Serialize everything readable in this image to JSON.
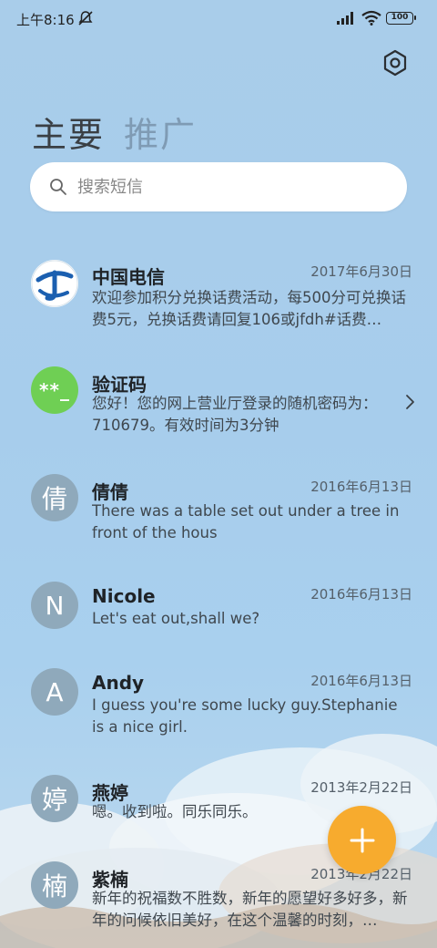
{
  "status_bar": {
    "time": "上午8:16",
    "battery": "100"
  },
  "tabs": [
    {
      "label": "主要"
    },
    {
      "label": "推广"
    }
  ],
  "search": {
    "placeholder": "搜索短信"
  },
  "conversations": [
    {
      "name": "中国电信",
      "date": "2017年6月30日",
      "preview": "欢迎参加积分兑换话费活动，每500分可兑换话费5元，兑换话费请回复106或jfdh#话费…",
      "avatar": "telecom-logo"
    },
    {
      "name": "验证码",
      "date": "",
      "preview": "您好！您的网上营业厅登录的随机密码为：710679。有效时间为3分钟",
      "avatar_text": "**_"
    },
    {
      "name": "倩倩",
      "date": "2016年6月13日",
      "preview": "There was a table set out under a tree in front of the hous",
      "avatar_text": "倩"
    },
    {
      "name": "Nicole",
      "date": "2016年6月13日",
      "preview": "Let's eat out,shall we?",
      "avatar_text": "N"
    },
    {
      "name": "Andy",
      "date": "2016年6月13日",
      "preview": "I guess you're some lucky guy.Stephanie is a nice girl.",
      "avatar_text": "A"
    },
    {
      "name": "燕婷",
      "date": "2013年2月22日",
      "preview": "嗯。收到啦。同乐同乐。",
      "avatar_text": "婷"
    },
    {
      "name": "紫楠",
      "date": "2013年2月22日",
      "preview": "新年的祝福数不胜数，新年的愿望好多好多，新年的问候依旧美好，在这个温馨的时刻，…",
      "avatar_text": "楠"
    }
  ],
  "colors": {
    "fab": "#f7ab2e",
    "code_avatar": "#6fcf54",
    "letter_avatar": "#8fa9bb"
  },
  "icons": [
    "mute-icon",
    "signal-icon",
    "wifi-icon",
    "battery-icon",
    "settings-icon",
    "search-icon",
    "chevron-right-icon",
    "plus-icon"
  ]
}
